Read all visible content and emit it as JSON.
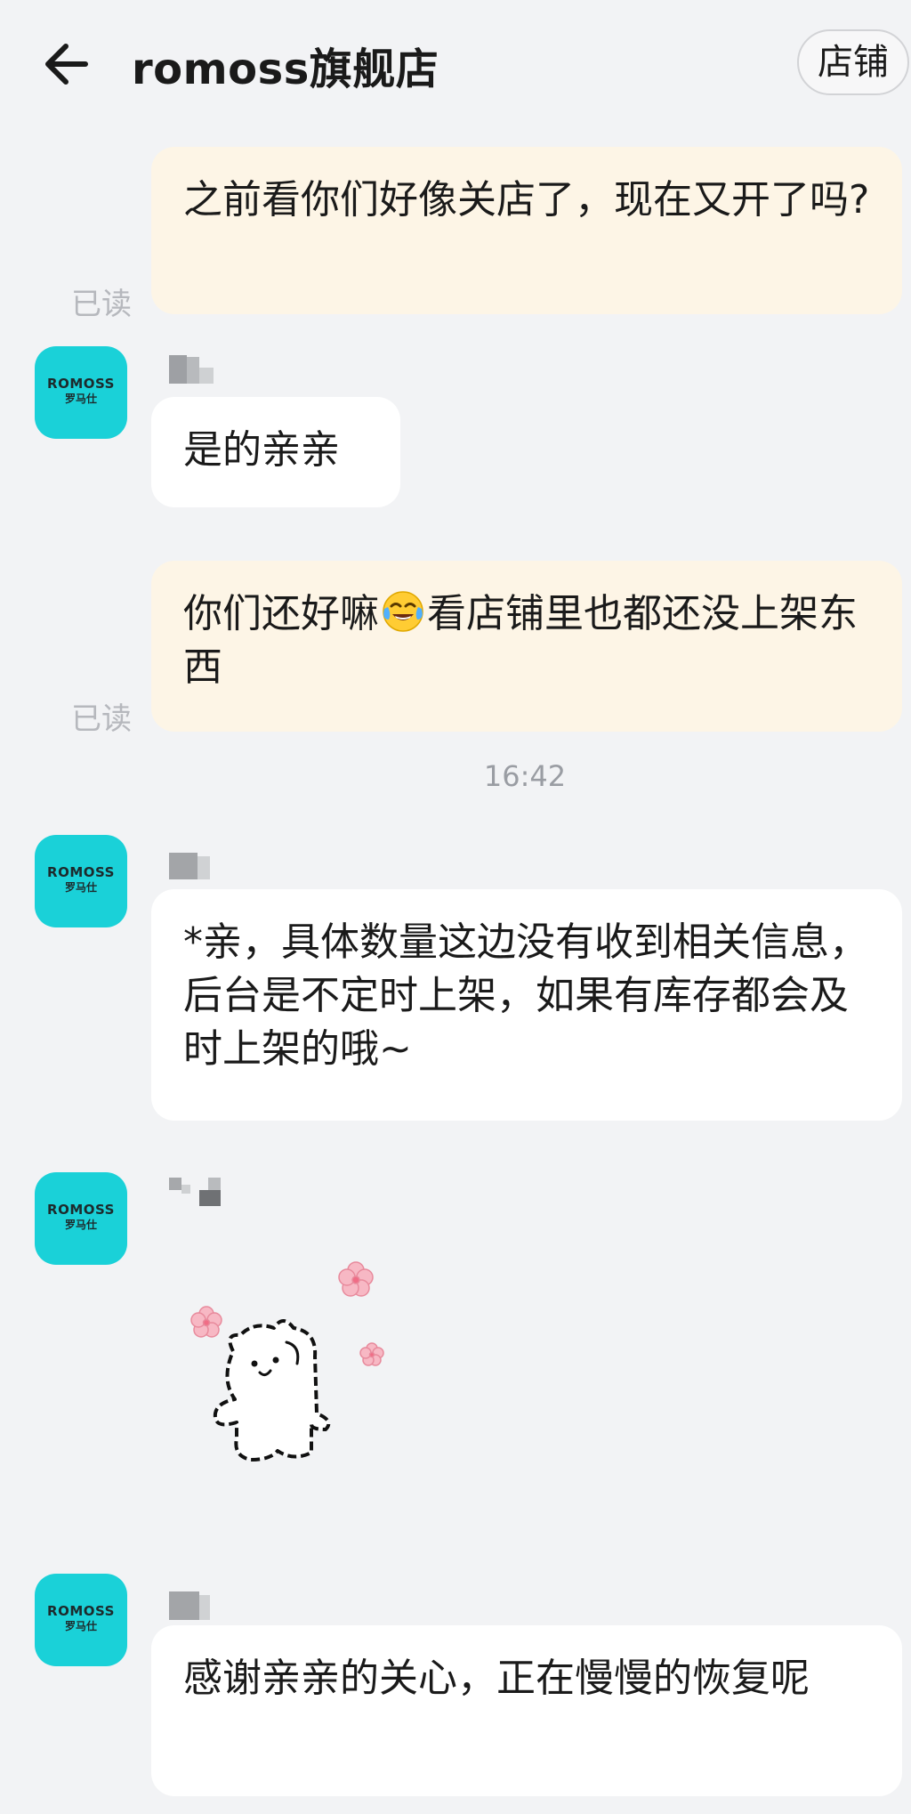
{
  "header": {
    "title": "romoss旗舰店",
    "shop_button": "店铺"
  },
  "avatar": {
    "brand": "ROMOSS",
    "cn": "罗马仕",
    "color": "#1ad1d8"
  },
  "messages": [
    {
      "side": "out",
      "text": "之前看你们好像关店了，现在又开了吗?",
      "status": "已读"
    },
    {
      "side": "in",
      "text": "是的亲亲"
    },
    {
      "side": "out",
      "text_before": "你们还好嘛",
      "emoji": "face-with-tears-of-joy",
      "text_after": "看店铺里也都还没上架东西",
      "status": "已读"
    },
    {
      "side": "time",
      "text": "16:42"
    },
    {
      "side": "in",
      "text": "*亲，具体数量这边没有收到相关信息，后台是不定时上架，如果有库存都会及时上架的哦~"
    },
    {
      "side": "in",
      "type": "sticker",
      "sticker": "white-bear-with-pink-flowers"
    },
    {
      "side": "in",
      "text": "感谢亲亲的关心，正在慢慢的恢复呢"
    }
  ],
  "colors": {
    "background": "#f2f3f5",
    "outgoing_bubble": "#fdf5e6",
    "incoming_bubble": "#ffffff",
    "read_status": "#b6b8bd"
  }
}
